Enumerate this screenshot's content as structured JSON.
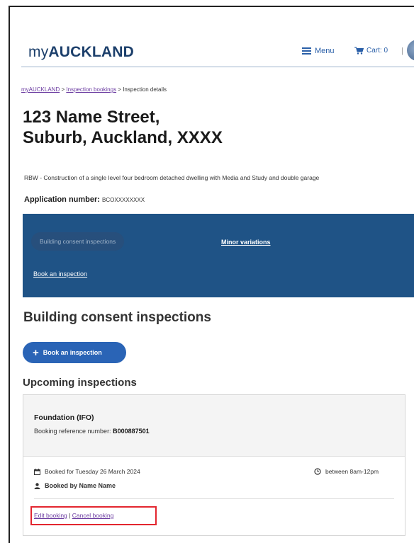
{
  "header": {
    "logo_prefix": "my",
    "logo_main": "AUCKLAND",
    "menu_label": "Menu",
    "cart_label": "Cart: 0",
    "separator": "|"
  },
  "breadcrumb": {
    "home": "myAUCKLAND",
    "sep1": " > ",
    "bookings": "Inspection bookings",
    "sep2": " > ",
    "current": "Inspection details"
  },
  "page": {
    "title_line1": "123 Name Street,",
    "title_line2": "Suburb, Auckland, XXXX",
    "description": "RBW - Construction of a single level four bedroom detached dwelling with Media and Study and double garage",
    "app_number_label": "Application number:",
    "app_number_value": "BCOXXXXXXXX"
  },
  "panel": {
    "active_tab": "Building consent inspections",
    "minor_variations": "Minor variations",
    "book_link": "Book an inspection"
  },
  "section": {
    "heading": "Building consent inspections",
    "book_button": "Book an inspection",
    "upcoming_heading": "Upcoming inspections"
  },
  "inspection": {
    "name": "Foundation (IFO)",
    "ref_label": "Booking reference number:",
    "ref_value": "B000887501",
    "booked_for": "Booked for Tuesday 26 March 2024",
    "time": "between 8am-12pm",
    "booked_by": "Booked by Name Name",
    "edit_label": "Edit booking",
    "action_sep": " | ",
    "cancel_label": "Cancel booking"
  },
  "colors": {
    "brand_navy": "#1c3f6b",
    "panel_blue": "#1f5386",
    "button_blue": "#2a64b6",
    "link_purple": "#6a3aa0",
    "highlight_red": "#e3262f"
  },
  "icons": {
    "menu": "hamburger-icon",
    "cart": "cart-icon",
    "calendar": "calendar-icon",
    "clock": "clock-icon",
    "user": "user-icon",
    "plus": "plus-icon"
  }
}
